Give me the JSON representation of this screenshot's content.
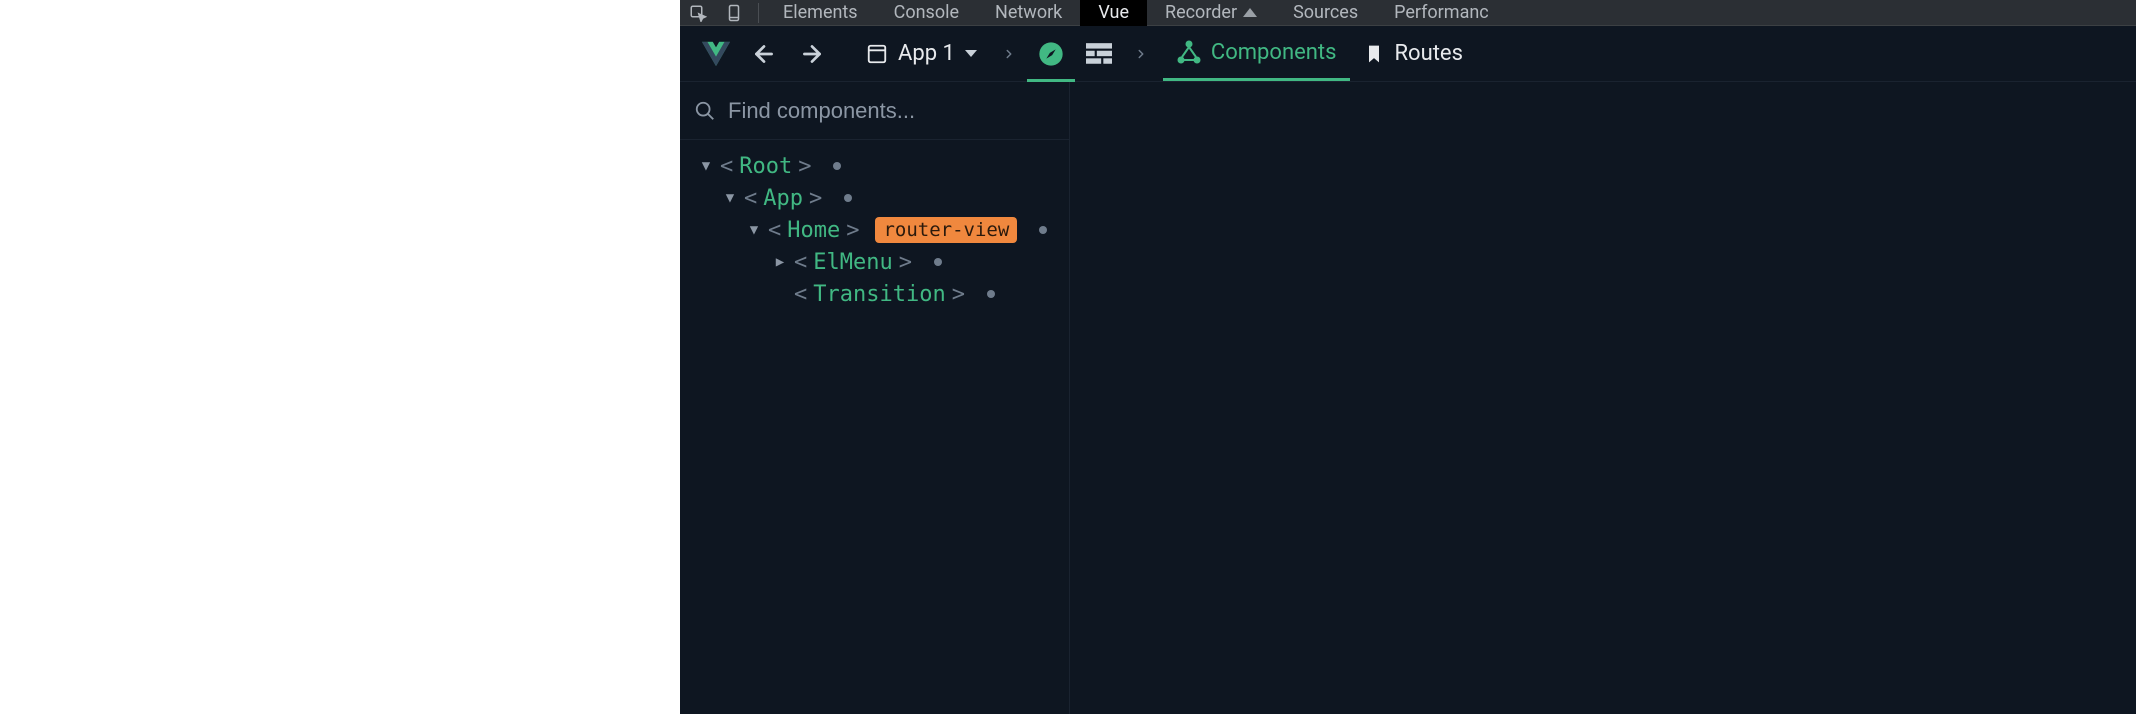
{
  "devtools_tabs": {
    "elements": "Elements",
    "console": "Console",
    "network": "Network",
    "vue": "Vue",
    "recorder": "Recorder",
    "sources": "Sources",
    "performance": "Performanc"
  },
  "vuebar": {
    "app_label": "App 1",
    "components_label": "Components",
    "routes_label": "Routes"
  },
  "search": {
    "placeholder": "Find components..."
  },
  "tree": {
    "root": "Root",
    "app": "App",
    "home": "Home",
    "home_badge": "router-view",
    "elmenu": "ElMenu",
    "transition": "Transition"
  }
}
